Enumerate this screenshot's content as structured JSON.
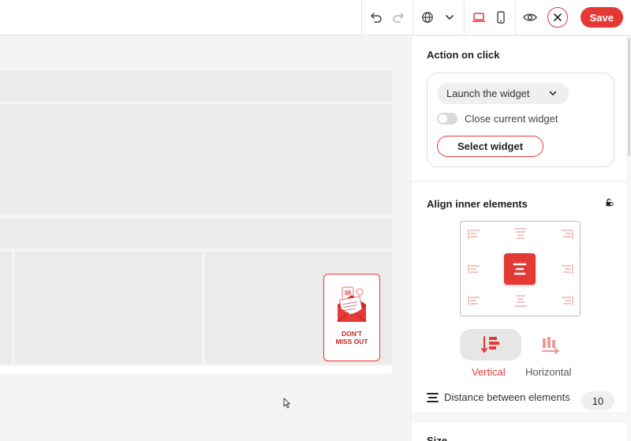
{
  "toolbar": {
    "undo_icon": "undo-icon",
    "redo_icon": "redo-icon",
    "language_icon": "globe-icon",
    "desktop_icon": "laptop-icon",
    "mobile_icon": "phone-icon",
    "preview_icon": "eye-icon",
    "close_icon": "close-icon",
    "save_label": "Save",
    "accent_color": "#e53935"
  },
  "canvas": {
    "widget": {
      "text_line1": "DON'T",
      "text_line2": "MISS OUT",
      "icon": "envelope-icon"
    }
  },
  "panel": {
    "action": {
      "title": "Action on click",
      "selected_action": "Launch the widget",
      "toggle_label": "Close current widget",
      "toggle_on": false,
      "select_button": "Select widget"
    },
    "align": {
      "title": "Align inner elements",
      "lock_icon": "lock-icon",
      "selected_position": "middle-center",
      "direction_options": [
        {
          "label": "Vertical",
          "active": true
        },
        {
          "label": "Horizontal",
          "active": false
        }
      ],
      "distance_label": "Distance between elements",
      "distance_value": "10"
    },
    "size_title": "Size"
  }
}
